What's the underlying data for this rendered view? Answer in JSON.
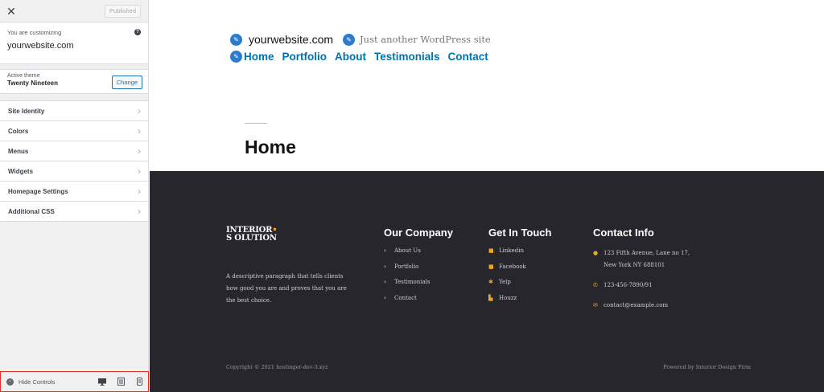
{
  "customizer": {
    "close_glyph": "✕",
    "publish_label": "Published",
    "customizing_label": "You are customizing",
    "site_name": "yourwebsite.com",
    "help_glyph": "?",
    "active_theme_label": "Active theme",
    "theme_name": "Twenty Nineteen",
    "change_label": "Change",
    "menu": [
      {
        "label": "Site Identity"
      },
      {
        "label": "Colors"
      },
      {
        "label": "Menus"
      },
      {
        "label": "Widgets"
      },
      {
        "label": "Homepage Settings"
      },
      {
        "label": "Additional CSS"
      }
    ],
    "hide_controls_label": "Hide Controls",
    "devices": [
      "desktop-icon",
      "tablet-icon",
      "mobile-icon"
    ]
  },
  "preview": {
    "site_title": "yourwebsite.com",
    "tagline": "Just another WordPress site",
    "nav": [
      "Home",
      "Portfolio",
      "About",
      "Testimonials",
      "Contact"
    ],
    "page_title": "Home",
    "footer": {
      "logo_line1": "INTERIOR",
      "logo_line2": "S OLUTION",
      "description": "A descriptive paragraph that tells clients how good you are and proves that you are the best choice.",
      "company": {
        "heading": "Our Company",
        "links": [
          "About Us",
          "Portfolio",
          "Testimonials",
          "Contact"
        ]
      },
      "touch": {
        "heading": "Get In Touch",
        "links": [
          "Linkedin",
          "Facebook",
          "Yelp",
          "Houzz"
        ]
      },
      "contact": {
        "heading": "Contact Info",
        "address_line1": "123 Fifth Avenue, Lane no 17,",
        "address_line2": "New York NY 688101",
        "phone": "123-456-7890/91",
        "email": "contact@example.com"
      },
      "copyright": "Copyright © 2021 hostinger-dev-3.xyz",
      "powered": "Powered by Interior Design Firm"
    }
  },
  "colors": {
    "accent": "#2d7ccc",
    "nav_link": "#0073aa",
    "footer_bg": "#26262c",
    "footer_icon": "#e9a825",
    "highlight_border": "#e0302a"
  }
}
